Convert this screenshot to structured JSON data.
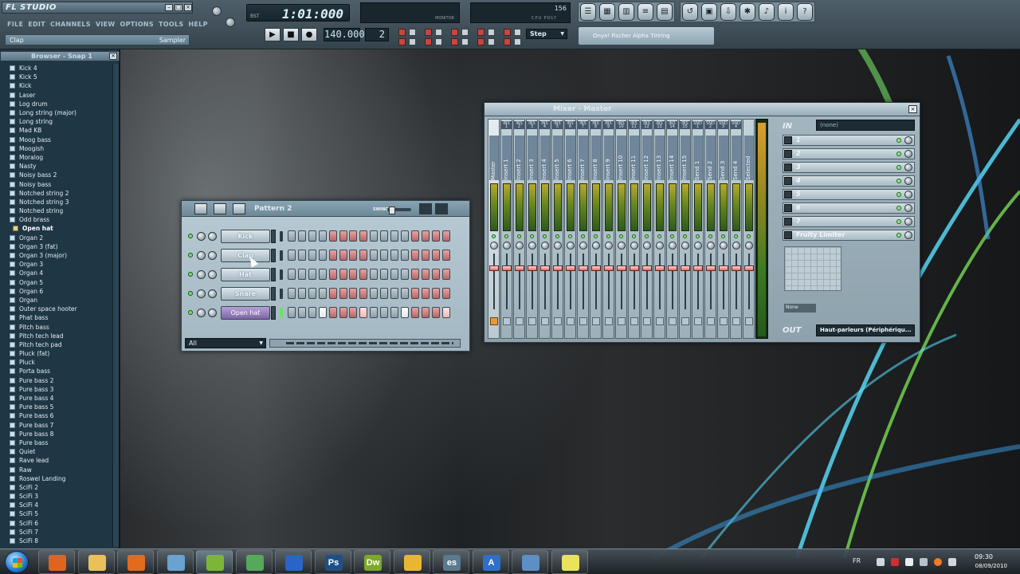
{
  "app": {
    "logo": "FL STUDIO",
    "menu": [
      "FILE",
      "EDIT",
      "CHANNELS",
      "VIEW",
      "OPTIONS",
      "TOOLS",
      "HELP"
    ],
    "hint_name": "Clap",
    "hint_type": "Sampler"
  },
  "transport": {
    "time": "1:01:000",
    "time_unit": "BST",
    "tempo": "140.000",
    "pattern_number": "2",
    "snap": "Step",
    "monitor_label": "MONITOR",
    "cpu_value": "156",
    "cpu_labels": "CPU POLY"
  },
  "plugin_bar_text": "Onyx! Fischer Alpha Tiriring",
  "browser": {
    "title": "Browser - Snap 1",
    "items": [
      "Kick 4",
      "Kick 5",
      "Kick",
      "Laser",
      "Log drum",
      "Long string (major)",
      "Long string",
      "Mad KB",
      "Moog bass",
      "Moogish",
      "Moralog",
      "Nasty",
      "Noisy bass 2",
      "Noisy bass",
      "Notched string 2",
      "Notched string 3",
      "Notched string",
      "Odd brass",
      "Open hat",
      "Organ 2",
      "Organ 3 (fat)",
      "Organ 3 (major)",
      "Organ 3",
      "Organ 4",
      "Organ 5",
      "Organ 6",
      "Organ",
      "Outer space hooter",
      "Phat bass",
      "Pitch bass",
      "Pitch tech lead",
      "Pitch tech pad",
      "Pluck (fat)",
      "Pluck",
      "Porta bass",
      "Pure bass 2",
      "Pure bass 3",
      "Pure bass 4",
      "Pure bass 5",
      "Pure bass 6",
      "Pure bass 7",
      "Pure bass 8",
      "Pure bass",
      "Quiet",
      "Rave lead",
      "Raw",
      "Roswel Landing",
      "SciFi 2",
      "SciFi 3",
      "SciFi 4",
      "SciFi 5",
      "SciFi 6",
      "SciFi 7",
      "SciFi 8"
    ],
    "selected_folder": "Open hat"
  },
  "step_sequencer": {
    "pattern": "Pattern 2",
    "swing_label": "SWING",
    "filter": "All",
    "channels": [
      {
        "name": "Kick",
        "selected": false,
        "steps_on": []
      },
      {
        "name": "Clap",
        "selected": false,
        "steps_on": []
      },
      {
        "name": "Hat",
        "selected": false,
        "steps_on": []
      },
      {
        "name": "Snare",
        "selected": false,
        "steps_on": []
      },
      {
        "name": "Open hat",
        "selected": true,
        "steps_on": [
          3,
          7,
          11,
          15
        ]
      }
    ]
  },
  "mixer": {
    "title": "Mixer - Master",
    "tracks": [
      "Master",
      "Insert 1",
      "Insert 2",
      "Insert 3",
      "Insert 4",
      "Insert 5",
      "Insert 6",
      "Insert 7",
      "Insert 8",
      "Insert 9",
      "Insert 10",
      "Insert 11",
      "Insert 12",
      "Insert 13",
      "Insert 14",
      "Insert 15",
      "Send 1",
      "Send 2",
      "Send 3",
      "Send 4",
      "Selected"
    ],
    "track_codes": [
      "",
      "INS 1",
      "INS 2",
      "INS 3",
      "INS 4",
      "INS 5",
      "INS 6",
      "INS 7",
      "INS 8",
      "INS 9",
      "INS 10",
      "INS 11",
      "INS 12",
      "INS 13",
      "INS 14",
      "INS 15",
      "SND 1",
      "SND 2",
      "SND 3",
      "SND 4",
      ""
    ],
    "in_label": "IN",
    "in_value": "(none)",
    "fx_slots": [
      "1",
      "2",
      "3",
      "4",
      "5",
      "6",
      "7",
      "Fruity Limiter"
    ],
    "route_value": "None",
    "out_label": "OUT",
    "out_value": "Haut-parleurs (Périphériqu..."
  },
  "taskbar": {
    "apps": [
      {
        "name": "Firefox",
        "letter": "",
        "color": "#e0641d"
      },
      {
        "name": "Explorer",
        "letter": "",
        "color": "#e8c15a"
      },
      {
        "name": "Media",
        "letter": "",
        "color": "#e26b1e"
      },
      {
        "name": "Network",
        "letter": "",
        "color": "#6aa2d0"
      },
      {
        "name": "FL Studio",
        "letter": "",
        "color": "#7db636"
      },
      {
        "name": "Messenger",
        "letter": "",
        "color": "#56a85a"
      },
      {
        "name": "Bluetooth",
        "letter": "",
        "color": "#2a64c8"
      },
      {
        "name": "Photoshop",
        "letter": "Ps",
        "color": "#1f4f86"
      },
      {
        "name": "Dreamweaver",
        "letter": "Dw",
        "color": "#7ea82a"
      },
      {
        "name": "Flash",
        "letter": "",
        "color": "#e8b732"
      },
      {
        "name": "es",
        "letter": "es",
        "color": "#5a7a8e"
      },
      {
        "name": "A",
        "letter": "A",
        "color": "#2f6fc8"
      },
      {
        "name": "Computer",
        "letter": "",
        "color": "#5d8ec4"
      },
      {
        "name": "Notes",
        "letter": "",
        "color": "#e9e25a"
      }
    ],
    "language": "FR",
    "time": "09:30",
    "date": "08/09/2010"
  },
  "colors": {
    "accent": "#7c64a8",
    "step_red": "#b76767",
    "step_gray": "#8d9ea8"
  }
}
